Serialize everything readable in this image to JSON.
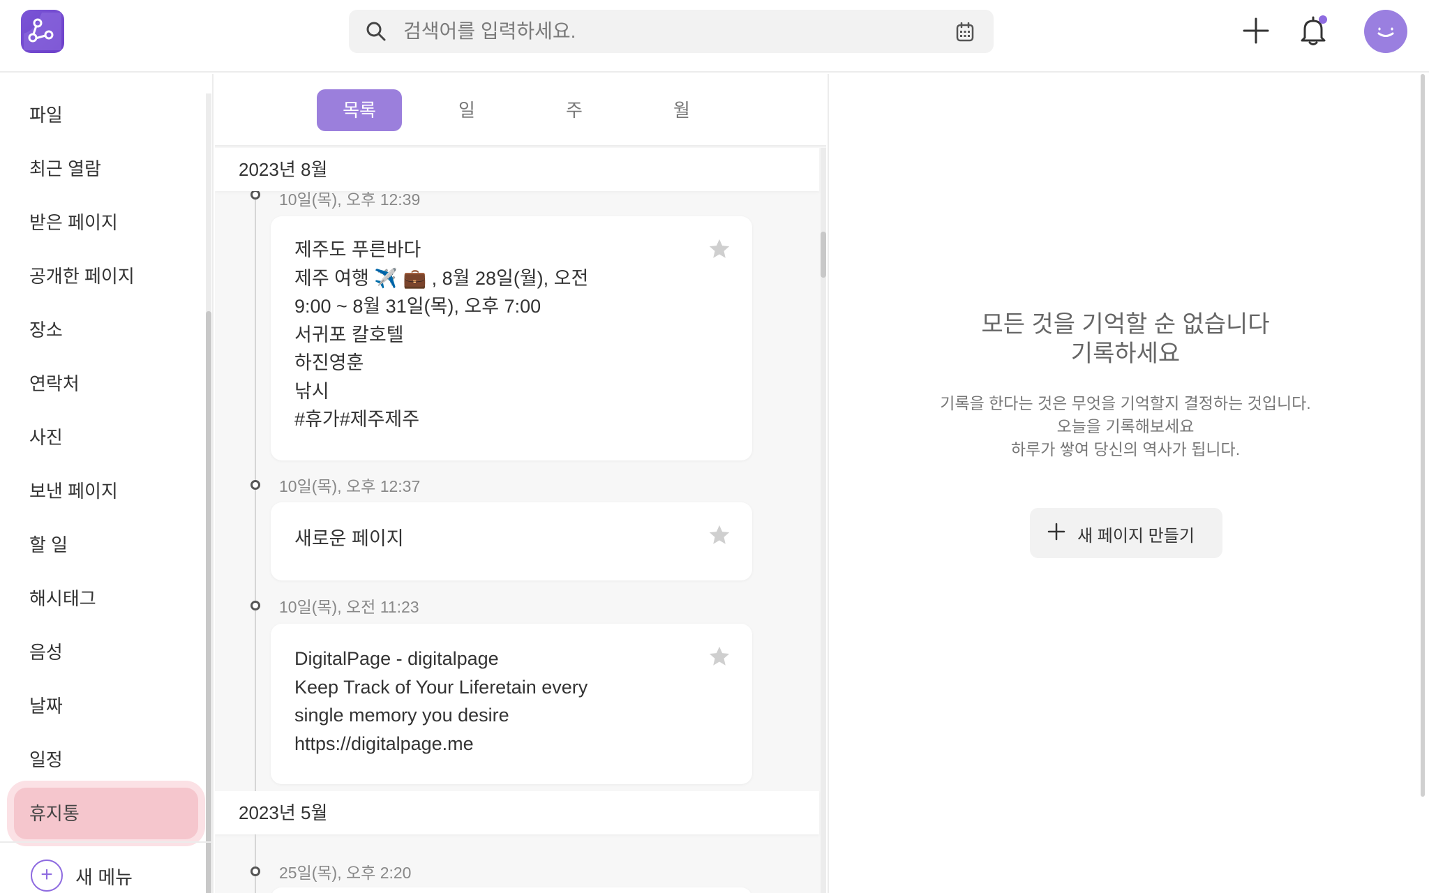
{
  "header": {
    "search_placeholder": "검색어를 입력하세요."
  },
  "sidebar": {
    "items": [
      {
        "label": "파일"
      },
      {
        "label": "최근 열람"
      },
      {
        "label": "받은 페이지"
      },
      {
        "label": "공개한 페이지"
      },
      {
        "label": "장소"
      },
      {
        "label": "연락처"
      },
      {
        "label": "사진"
      },
      {
        "label": "보낸 페이지"
      },
      {
        "label": "할 일"
      },
      {
        "label": "해시태그"
      },
      {
        "label": "음성"
      },
      {
        "label": "날짜"
      },
      {
        "label": "일정"
      },
      {
        "label": "휴지통"
      }
    ],
    "active_label": "휴지통",
    "new_menu_label": "새 메뉴"
  },
  "tabs": [
    {
      "label": "목록",
      "active": true
    },
    {
      "label": "일"
    },
    {
      "label": "주"
    },
    {
      "label": "월"
    }
  ],
  "timeline": {
    "groups": [
      {
        "month": "2023년 8월",
        "entries": [
          {
            "time": "10일(목), 오후 12:39",
            "lines": [
              "제주도 푸른바다",
              "제주 여행 ✈️ 💼 , 8월 28일(월), 오전",
              "9:00 ~ 8월 31일(목), 오후 7:00",
              "서귀포 칼호텔",
              "하진영훈",
              "낚시",
              "#휴가#제주제주"
            ]
          },
          {
            "time": "10일(목), 오후 12:37",
            "lines": [
              "새로운 페이지"
            ]
          },
          {
            "time": "10일(목), 오전 11:23",
            "lines": [
              "DigitalPage - digitalpage",
              "Keep Track of Your Liferetain every",
              "single memory you desire",
              "https://digitalpage.me"
            ]
          }
        ]
      },
      {
        "month": "2023년 5월",
        "entries": [
          {
            "time": "25일(목), 오후 2:20",
            "lines": []
          }
        ]
      }
    ]
  },
  "empty_state": {
    "title_line1": "모든 것을 기억할 순 없습니다",
    "title_line2": "기록하세요",
    "desc_line1": "기록을 한다는 것은 무엇을 기억할지 결정하는 것입니다.",
    "desc_line2": "오늘을 기록해보세요",
    "desc_line3": "하루가 쌓여 당신의 역사가 됩니다.",
    "button_label": "새 페이지 만들기"
  },
  "icons": {
    "logo": "app-logo",
    "search": "search-icon",
    "calendar": "calendar-icon",
    "add": "plus-icon",
    "notification": "bell-icon",
    "avatar": "smiley-avatar",
    "favorite": "star-icon"
  },
  "colors": {
    "accent": "#9b7fdc",
    "brand": "#6c3fc9",
    "active_sidebar": "#f5c6cd"
  }
}
